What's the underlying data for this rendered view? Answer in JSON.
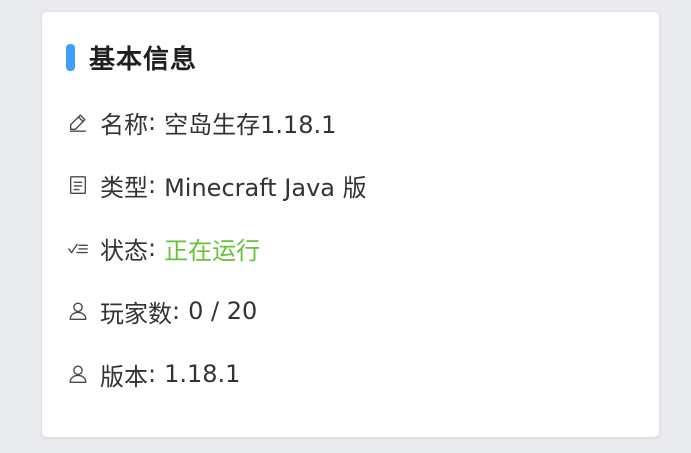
{
  "card": {
    "title": "基本信息",
    "accent_color": "#409eff",
    "fields": [
      {
        "icon": "edit-pencil-icon",
        "label": "名称",
        "value": "空岛生存1.18.1"
      },
      {
        "icon": "document-icon",
        "label": "类型",
        "value": "Minecraft Java 版"
      },
      {
        "icon": "checklist-icon",
        "label": "状态",
        "value": "正在运行",
        "value_color": "#67c23a"
      },
      {
        "icon": "user-icon",
        "label": "玩家数",
        "value": "0 / 20"
      },
      {
        "icon": "user-icon",
        "label": "版本",
        "value": "1.18.1"
      }
    ]
  }
}
